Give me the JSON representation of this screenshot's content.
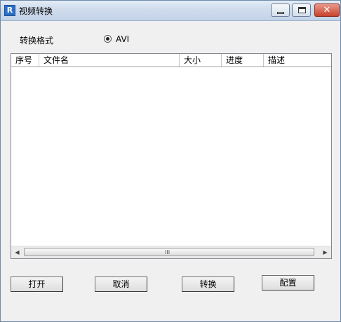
{
  "window": {
    "title": "视频转换",
    "app_icon": "app-logo-icon"
  },
  "format": {
    "label": "转换格式",
    "option": "AVI",
    "selected": true
  },
  "list": {
    "columns": [
      "序号",
      "文件名",
      "大小",
      "进度",
      "描述"
    ],
    "rows": []
  },
  "scrollbar": {
    "grip": "III"
  },
  "buttons": {
    "open": "打开",
    "cancel": "取消",
    "convert": "转换",
    "config": "配置"
  }
}
